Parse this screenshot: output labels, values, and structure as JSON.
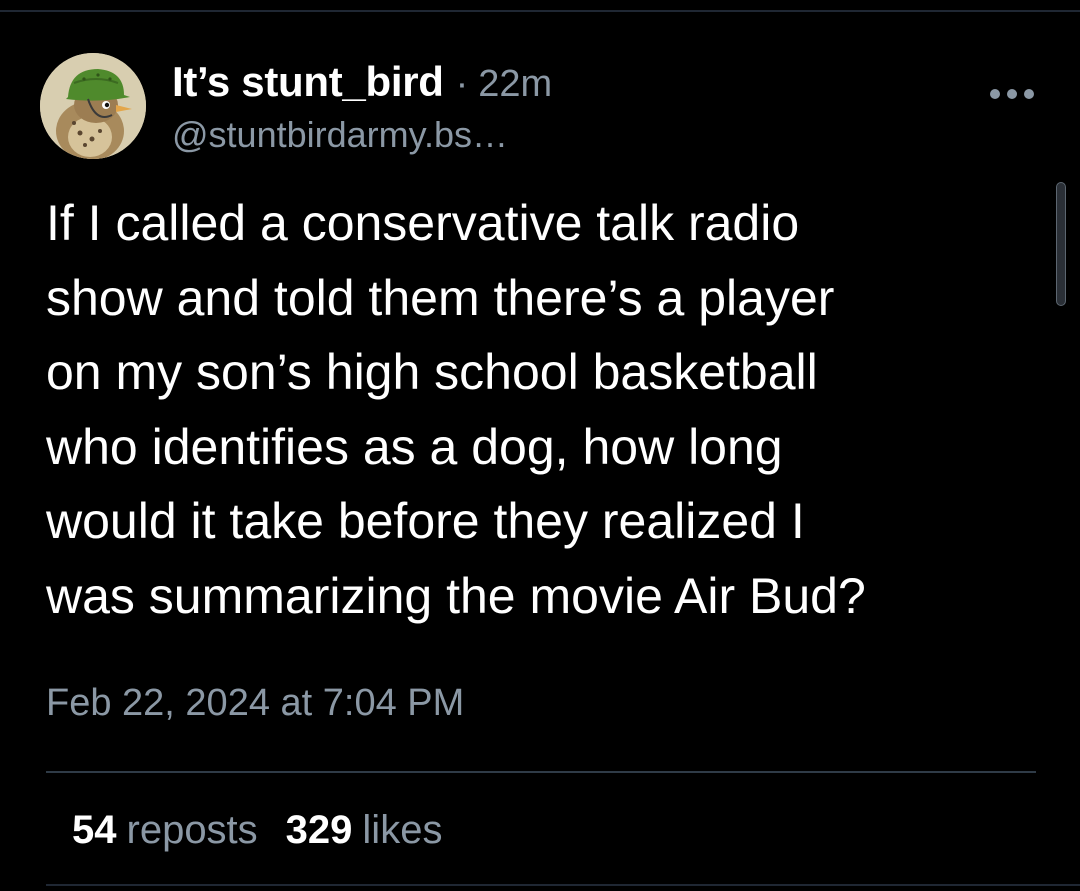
{
  "post": {
    "author": {
      "display_name": "It’s stunt_bird",
      "handle": "@stuntbirdarmy.bs…",
      "avatar_icon": "bird-with-army-helmet-avatar"
    },
    "separator": "·",
    "relative_time": "22m",
    "more_icon": "ellipsis-icon",
    "text": "If I called a conservative talk radio\nshow and told them there’s a player\non my son’s high school basketball\nwho identifies as a dog, how long\nwould it take before they realized I\nwas summarizing the movie Air Bud?",
    "date": "Feb 22, 2024 at 7:04 PM",
    "stats": {
      "reposts_count": "54",
      "reposts_label": "reposts",
      "likes_count": "329",
      "likes_label": "likes"
    }
  },
  "colors": {
    "background": "#000000",
    "text_primary": "#ffffff",
    "text_secondary": "#8b98a5",
    "divider": "#2f3b47"
  }
}
